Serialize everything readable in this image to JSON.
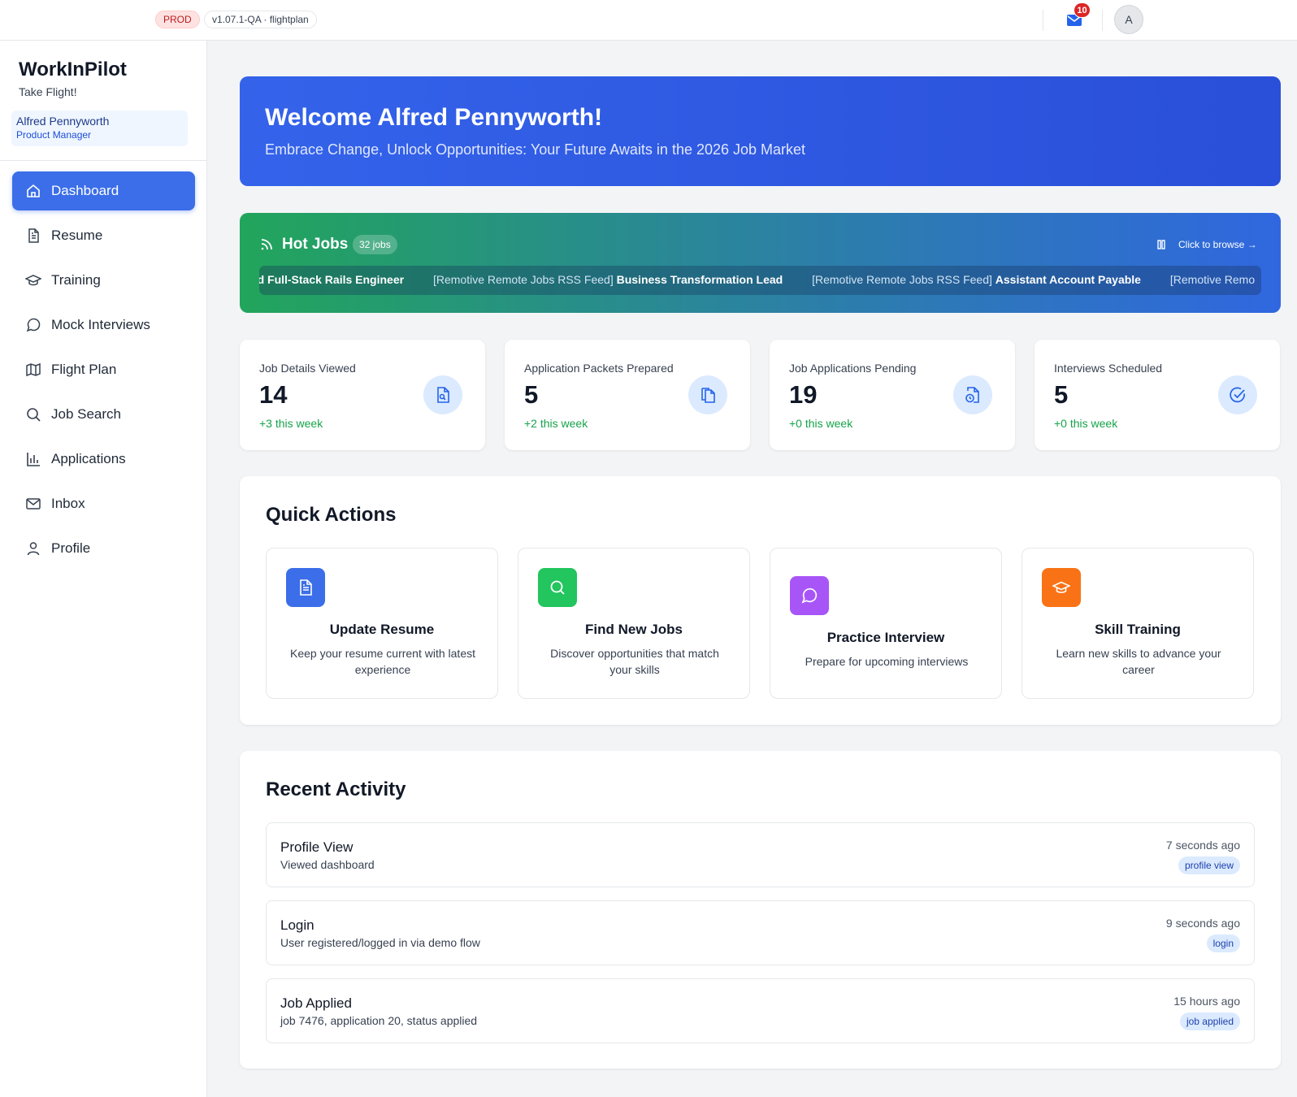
{
  "topbar": {
    "env": "PROD",
    "version": "v1.07.1-QA · flightplan",
    "mail_icon": "mail-icon",
    "mail_count": "10",
    "avatar_initial": "A"
  },
  "sidebar": {
    "brand": "WorkInPilot",
    "tagline": "Take Flight!",
    "user_name": "Alfred Pennyworth",
    "user_role": "Product Manager",
    "items": [
      {
        "label": "Dashboard",
        "icon": "home-icon",
        "active": true
      },
      {
        "label": "Resume",
        "icon": "document-icon"
      },
      {
        "label": "Training",
        "icon": "graduation-cap-icon"
      },
      {
        "label": "Mock Interviews",
        "icon": "chat-bubble-icon"
      },
      {
        "label": "Flight Plan",
        "icon": "map-icon"
      },
      {
        "label": "Job Search",
        "icon": "search-icon"
      },
      {
        "label": "Applications",
        "icon": "bar-chart-icon"
      },
      {
        "label": "Inbox",
        "icon": "mail-icon"
      },
      {
        "label": "Profile",
        "icon": "user-icon"
      }
    ]
  },
  "welcome": {
    "title": "Welcome Alfred Pennyworth!",
    "subtitle": "Embrace Change, Unlock Opportunities: Your Future Awaits in the 2026 Job Market"
  },
  "hot_jobs": {
    "title": "Hot Jobs",
    "count": "32 jobs",
    "browse": "Click to browse →",
    "ticker": [
      {
        "source": "",
        "title": "ead Full-Stack Rails Engineer"
      },
      {
        "source": "[Remotive Remote Jobs RSS Feed]",
        "title": "Business Transformation Lead"
      },
      {
        "source": "[Remotive Remote Jobs RSS Feed]",
        "title": "Assistant Account Payable"
      },
      {
        "source": "[Remotive Remo",
        "title": ""
      }
    ]
  },
  "stats": [
    {
      "label": "Job Details Viewed",
      "value": "14",
      "delta": "+3 this week",
      "icon": "file-search-icon"
    },
    {
      "label": "Application Packets Prepared",
      "value": "5",
      "delta": "+2 this week",
      "icon": "copy-documents-icon"
    },
    {
      "label": "Job Applications Pending",
      "value": "19",
      "delta": "+0 this week",
      "icon": "file-clock-icon"
    },
    {
      "label": "Interviews Scheduled",
      "value": "5",
      "delta": "+0 this week",
      "icon": "check-circle-icon"
    }
  ],
  "quick_actions": {
    "title": "Quick Actions",
    "cards": [
      {
        "title": "Update Resume",
        "desc": "Keep your resume current with latest experience",
        "icon": "document-icon",
        "color": "#3b6ee8"
      },
      {
        "title": "Find New Jobs",
        "desc": "Discover opportunities that match your skills",
        "icon": "search-icon",
        "color": "#22c55e"
      },
      {
        "title": "Practice Interview",
        "desc": "Prepare for upcoming interviews",
        "icon": "chat-bubble-icon",
        "color": "#a855f7"
      },
      {
        "title": "Skill Training",
        "desc": "Learn new skills to advance your career",
        "icon": "graduation-cap-icon",
        "color": "#f97316"
      }
    ]
  },
  "recent_activity": {
    "title": "Recent Activity",
    "items": [
      {
        "title": "Profile View",
        "desc": "Viewed dashboard",
        "time": "7 seconds ago",
        "tag": "profile view"
      },
      {
        "title": "Login",
        "desc": "User registered/logged in via demo flow",
        "time": "9 seconds ago",
        "tag": "login"
      },
      {
        "title": "Job Applied",
        "desc": "job 7476, application 20, status applied",
        "time": "15 hours ago",
        "tag": "job applied"
      }
    ]
  }
}
